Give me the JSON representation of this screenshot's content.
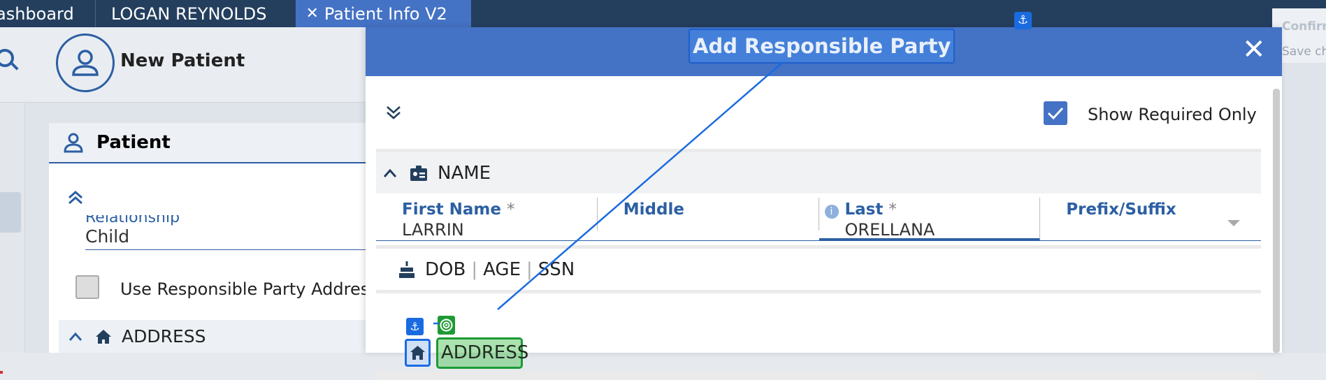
{
  "tabs": [
    "ashboard",
    "LOGAN REYNOLDS",
    "Patient Info V2"
  ],
  "header": {
    "title": "New Patient"
  },
  "patient_card": {
    "title": "Patient",
    "relationship_label": "Relationship",
    "relationship_value": "Child",
    "use_rp_address_label": "Use Responsible Party Address",
    "address_section": "ADDRESS"
  },
  "confirm_panel": {
    "title": "Confirm",
    "subtitle": "Save ch"
  },
  "modal": {
    "title": "Add Responsible Party",
    "close_symbol": "✕",
    "anchor_symbol": "⚓",
    "show_required_label": "Show Required Only",
    "show_required_checked": true,
    "name_section": "NAME",
    "fields": [
      {
        "label": "First Name",
        "required": true,
        "value": "LARRIN"
      },
      {
        "label": "Middle",
        "required": false,
        "value": ""
      },
      {
        "label": "Last",
        "required": true,
        "value": "ORELLANA"
      },
      {
        "label": "Prefix/Suffix",
        "required": false,
        "value": ""
      }
    ],
    "dob_section": [
      "DOB",
      "AGE",
      "SSN"
    ],
    "address_section": "ADDRESS"
  },
  "colors": {
    "brand": "#4472c4",
    "nav": "#243f5e",
    "anchor": "#1a6be0",
    "target": "#1d9a34"
  },
  "icons": [
    "search-icon",
    "user-icon",
    "chevron-double-up-icon",
    "home-icon",
    "chevron-up-icon",
    "id-card-icon",
    "chevron-double-down-icon",
    "check-icon",
    "info-icon",
    "cake-icon",
    "anchor-icon",
    "target-icon",
    "close-icon",
    "dropdown-caret-icon"
  ]
}
